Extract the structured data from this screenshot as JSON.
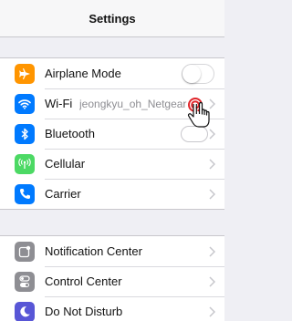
{
  "nav": {
    "title": "Settings"
  },
  "group1": [
    {
      "label": "Airplane Mode",
      "icon": "airplane-icon",
      "color": "#ff9500",
      "accessory": "toggle",
      "toggle_on": false
    },
    {
      "label": "Wi-Fi",
      "detail": "jeongkyu_oh_Netgear",
      "icon": "wifi-icon",
      "color": "#007aff",
      "accessory": "chevron"
    },
    {
      "label": "Bluetooth",
      "icon": "bluetooth-icon",
      "color": "#007aff",
      "accessory": "chevron"
    },
    {
      "label": "Cellular",
      "icon": "cellular-icon",
      "color": "#4cd964",
      "accessory": "chevron"
    },
    {
      "label": "Carrier",
      "icon": "phone-icon",
      "color": "#007aff",
      "accessory": "chevron"
    }
  ],
  "group2": [
    {
      "label": "Notification Center",
      "icon": "notification-center-icon",
      "color": "#8e8e93",
      "accessory": "chevron"
    },
    {
      "label": "Control Center",
      "icon": "control-center-icon",
      "color": "#8e8e93",
      "accessory": "chevron"
    },
    {
      "label": "Do Not Disturb",
      "icon": "moon-icon",
      "color": "#5856d6",
      "accessory": "chevron"
    }
  ],
  "cursor": {
    "icon": "hand-pointer-icon"
  }
}
